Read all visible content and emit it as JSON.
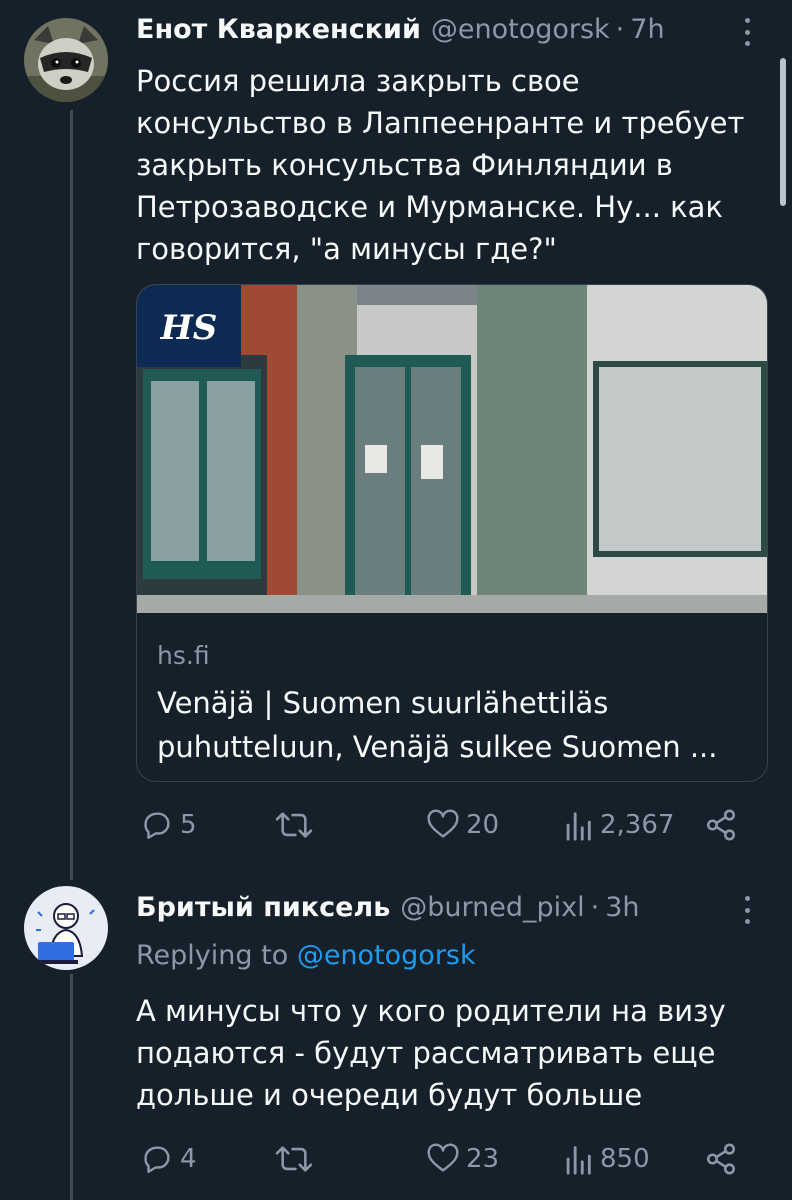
{
  "tweets": [
    {
      "author": "Енот Кваркенский",
      "handle": "@enotogorsk",
      "time": "7h",
      "text": "Россия решила закрыть свое\nконсульство в Лаппеенранте и требует\nзакрыть консульства Финляндии в\nПетрозаводске и Мурманске.  Ну...  как\nговорится, \"а минусы где?\"",
      "card": {
        "logo": "HS",
        "domain": "hs.fi",
        "title": "Venäjä | Suomen suurlähettiläs\npuhutteluun, Venäjä sulkee Suomen ..."
      },
      "actions": {
        "replies": "5",
        "retweets": "",
        "likes": "20",
        "views": "2,367"
      }
    },
    {
      "author": "Бритый пиксель",
      "handle": "@burned_pixl",
      "time": "3h",
      "replying_label": "Replying to",
      "replying_to": "@enotogorsk",
      "text": "А минусы что у кого родители на визу\nподаются - будут рассматривать еще\nдольше и очереди будут больше",
      "actions": {
        "replies": "4",
        "retweets": "",
        "likes": "23",
        "views": "850"
      }
    }
  ],
  "icons": [
    "avatar",
    "more-icon",
    "reply-icon",
    "retweet-icon",
    "like-icon",
    "views-icon",
    "share-icon"
  ],
  "colors": {
    "background": "#15202b",
    "text": "#f7f9f9",
    "secondary": "#8b98a5",
    "link": "#1d9bf0",
    "border": "#38444d"
  }
}
